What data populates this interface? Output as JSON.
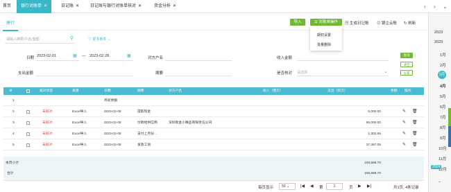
{
  "tabs": {
    "home": "首页",
    "bank_statement": "银行对账单",
    "journal": "日记账",
    "reconcile": "日记账与银行对账单核对",
    "fund_analysis": "资金分析"
  },
  "sub_tab": "建行",
  "toolbar": {
    "import": "导入",
    "statement_ops": "对账单操作",
    "generate_journal": "生成日记账",
    "bank_cloud": "银企云账",
    "refresh": "刷新"
  },
  "dropdown": {
    "items": [
      "期初设置",
      "批量删除"
    ]
  },
  "search": {
    "placeholder": "请输入摘要/户名/金额",
    "more_filters": "更多条件"
  },
  "filters": {
    "date_label": "日期",
    "date_start": "2023-02-01",
    "date_end": "2023-02-28",
    "counterparty_label": "对方户名",
    "income_label": "收入金额",
    "expense_label": "支出金额",
    "summary_label": "摘要",
    "reconciled_label": "是否核对",
    "reconciled_placeholder": "请选择"
  },
  "side_buttons": {
    "query": "查询",
    "clear": "清空",
    "settings": "设置"
  },
  "table": {
    "headers": [
      "",
      "核对状态",
      "来源",
      "日期",
      "摘要",
      "对方户名",
      "收入（借方）",
      "支出（贷方）",
      "余额",
      "操作"
    ],
    "rows": [
      {
        "no": "1",
        "status": "",
        "source": "",
        "date": "",
        "summary": "月初余额",
        "counterparty": "",
        "income": "",
        "expense": "",
        "has_cb": false,
        "has_ops": false
      },
      {
        "no": "2",
        "status": "未核对",
        "source": "Excel导入",
        "date": "2023-02-08",
        "summary": "提取现金",
        "counterparty": "",
        "income": "",
        "expense": "5,000.00",
        "has_cb": true,
        "has_ops": true
      },
      {
        "no": "3",
        "status": "未核对",
        "source": "Excel导入",
        "date": "2023-02-08",
        "summary": "付款给供应商",
        "counterparty": "深圳耿金小精品有限责任公司",
        "income": "",
        "expense": "65,000.00",
        "has_cb": true,
        "has_ops": true
      },
      {
        "no": "4",
        "status": "未核对",
        "source": "Excel导入",
        "date": "2023-02-08",
        "summary": "支付上月份...",
        "counterparty": "",
        "income": "",
        "expense": "1,302.65",
        "has_cb": true,
        "has_ops": true
      },
      {
        "no": "5",
        "status": "未核对",
        "source": "Excel导入",
        "date": "2023-02-08",
        "summary": "发放工资",
        "counterparty": "",
        "income": "",
        "expense": "37,367.05",
        "has_cb": true,
        "has_ops": true
      }
    ],
    "page_subtotal_label": "本页小计",
    "page_subtotal": "108,669.70",
    "total_label": "合计",
    "total": "108,669.70"
  },
  "pagination": {
    "per_page_label": "每页显示",
    "per_page": "50",
    "page_label": "第",
    "page": "1",
    "page_unit": "页",
    "summary": "共1页, 4条记录"
  },
  "months": {
    "year_top": "2023",
    "year_bottom": "2024",
    "items": [
      "1月",
      "2月",
      "3月",
      "4月",
      "5月",
      "6月",
      "7月",
      "8月",
      "9月",
      "10月",
      "11月",
      "12月"
    ],
    "active": "3月"
  },
  "colors": {
    "accent": "#3ab8c8",
    "green": "#72b835",
    "header": "#4bbbd3",
    "status_red": "#e0443c"
  }
}
